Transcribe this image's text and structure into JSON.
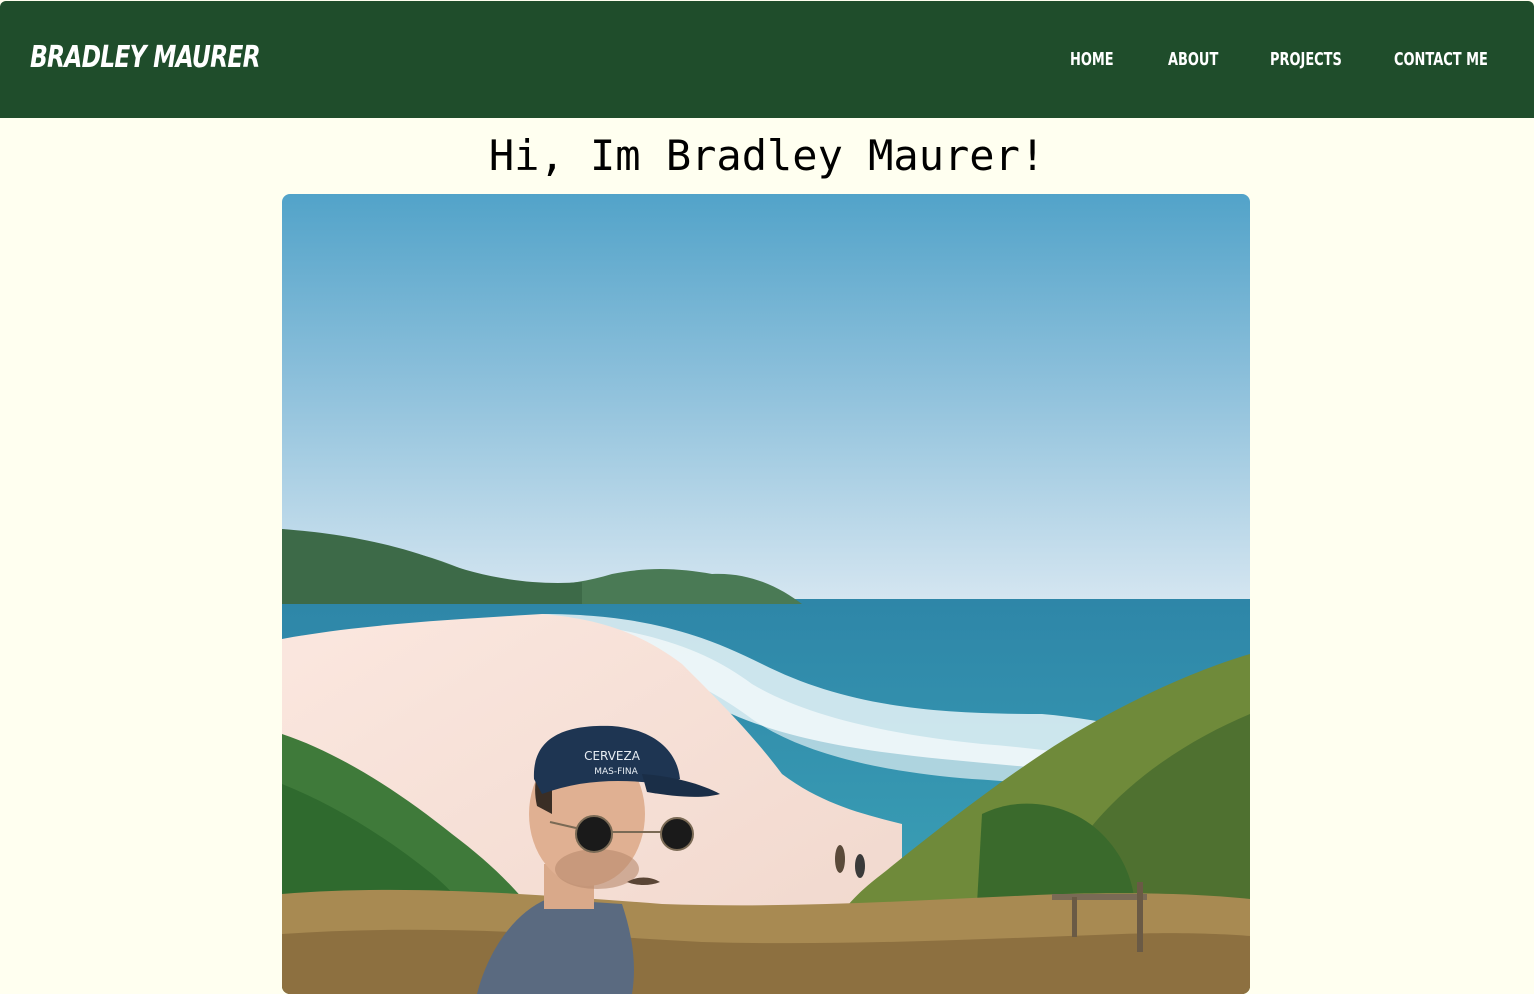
{
  "header": {
    "brand": "BRADLEY MAURER",
    "nav": [
      {
        "label": "HOME"
      },
      {
        "label": "ABOUT"
      },
      {
        "label": "PROJECTS"
      },
      {
        "label": "CONTACT ME"
      }
    ]
  },
  "main": {
    "greeting": "Hi, Im Bradley Maurer!",
    "photo": {
      "cap_text_line1": "CERVEZA",
      "cap_text_line2": "MAS-FINA"
    }
  },
  "colors": {
    "nav_background": "#1f4d2b",
    "page_background": "#fffff0",
    "nav_text": "#ffffff"
  }
}
